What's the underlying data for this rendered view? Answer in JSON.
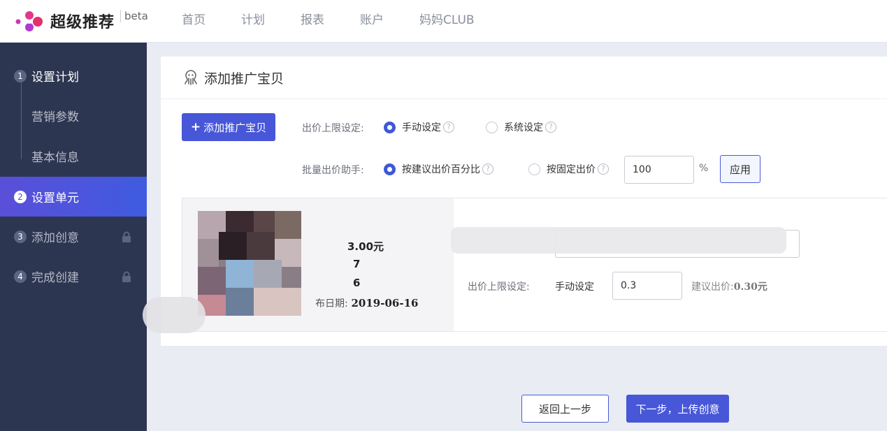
{
  "header": {
    "logo_text": "超级推荐",
    "logo_badge": "beta",
    "nav": [
      "首页",
      "计划",
      "报表",
      "账户",
      "妈妈CLUB"
    ]
  },
  "sidebar": {
    "steps": [
      {
        "num": "1",
        "label": "设置计划",
        "state": "done"
      },
      {
        "label": "营销参数",
        "sub": true
      },
      {
        "label": "基本信息",
        "sub": true
      },
      {
        "num": "2",
        "label": "设置单元",
        "state": "active"
      },
      {
        "num": "3",
        "label": "添加创意",
        "state": "locked"
      },
      {
        "num": "4",
        "label": "完成创建",
        "state": "locked"
      }
    ]
  },
  "card": {
    "title": "添加推广宝贝",
    "add_button": "添加推广宝贝",
    "add_button_icon": "+",
    "bid_limit_label": "出价上限设定:",
    "bid_limit_options": [
      "手动设定",
      "系统设定"
    ],
    "bid_limit_selected": "手动设定",
    "help_mark": "?",
    "batch_label": "批量出价助手:",
    "batch_options": [
      "按建议出价百分比",
      "按固定出价"
    ],
    "batch_selected": "按建议出价百分比",
    "batch_value": "100",
    "batch_unit": "%",
    "apply_label": "应用"
  },
  "item": {
    "price_partial": "3.00元",
    "stat1_partial": "7",
    "stat2_partial": "6",
    "date_label_partial": "布日期:",
    "date_value": "2019-06-16",
    "bid_limit_label": "出价上限设定:",
    "bid_mode": "手动设定",
    "bid_value": "0.3",
    "suggest_label": "建议出价:",
    "suggest_value": "0.30元"
  },
  "footer": {
    "back_label": "返回上一步",
    "next_label": "下一步，上传创意"
  },
  "colors": {
    "primary": "#4757d8",
    "sidebar_bg": "#2d3650",
    "page_bg": "#e9ecf3"
  }
}
